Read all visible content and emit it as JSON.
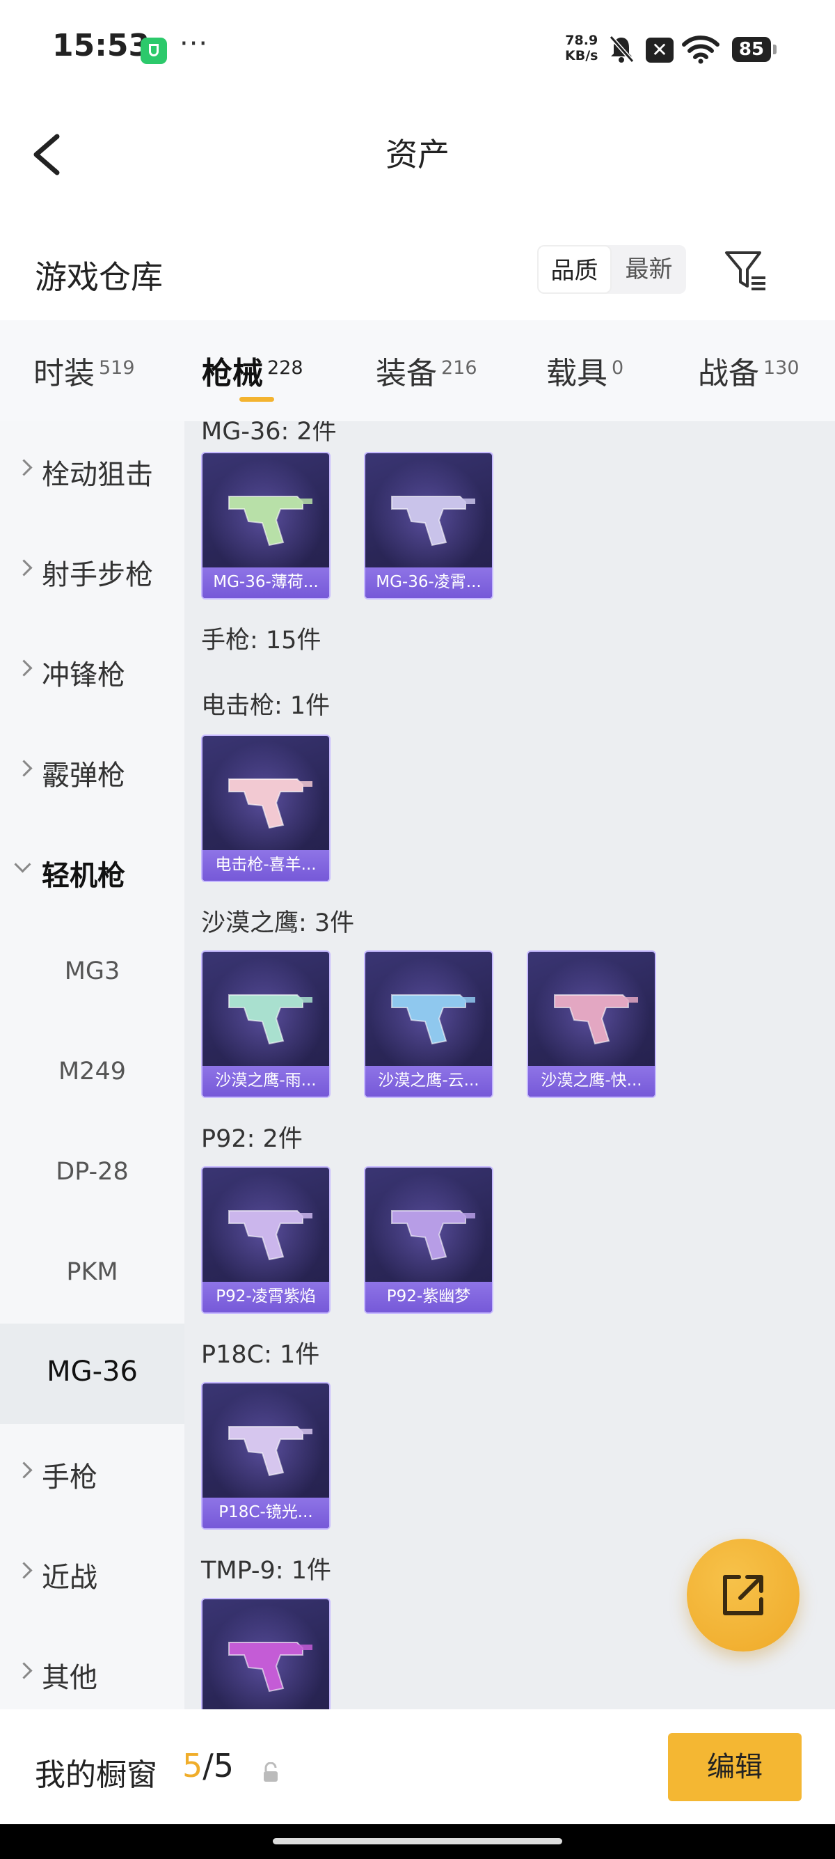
{
  "status": {
    "time": "15:53",
    "more": "···",
    "net_speed_value": "78.9",
    "net_speed_unit": "KB/s",
    "battery": "85"
  },
  "nav": {
    "title": "资产"
  },
  "warehouse": {
    "title": "游戏仓库",
    "sort": [
      "品质",
      "最新"
    ],
    "active_sort": 0
  },
  "tabs": [
    {
      "label": "时装",
      "count": "519"
    },
    {
      "label": "枪械",
      "count": "228",
      "active": true
    },
    {
      "label": "装备",
      "count": "216"
    },
    {
      "label": "载具",
      "count": "0"
    },
    {
      "label": "战备",
      "count": "130"
    }
  ],
  "sidebar": {
    "items": [
      {
        "label": "栓动狙击",
        "type": "category"
      },
      {
        "label": "射手步枪",
        "type": "category"
      },
      {
        "label": "冲锋枪",
        "type": "category"
      },
      {
        "label": "霰弹枪",
        "type": "category"
      },
      {
        "label": "轻机枪",
        "type": "category",
        "expanded": true
      },
      {
        "label": "MG3",
        "type": "sub"
      },
      {
        "label": "M249",
        "type": "sub"
      },
      {
        "label": "DP-28",
        "type": "sub"
      },
      {
        "label": "PKM",
        "type": "sub"
      },
      {
        "label": "MG-36",
        "type": "sub",
        "selected": true
      },
      {
        "label": "手枪",
        "type": "category"
      },
      {
        "label": "近战",
        "type": "category"
      },
      {
        "label": "其他",
        "type": "category"
      }
    ]
  },
  "groups": [
    {
      "title": "MG-36: 2件",
      "items": [
        {
          "name": "MG-36-薄荷...",
          "tint": "#b8e0a8"
        },
        {
          "name": "MG-36-凌霄...",
          "tint": "#c9c3ea"
        }
      ]
    },
    {
      "title": "手枪: 15件",
      "items": []
    },
    {
      "title": "电击枪: 1件",
      "items": [
        {
          "name": "电击枪-喜羊...",
          "tint": "#f2c9d2"
        }
      ]
    },
    {
      "title": "沙漠之鹰: 3件",
      "items": [
        {
          "name": "沙漠之鹰-雨...",
          "tint": "#a9e0cf"
        },
        {
          "name": "沙漠之鹰-云...",
          "tint": "#8fc8ee"
        },
        {
          "name": "沙漠之鹰-快...",
          "tint": "#e3a7c2"
        }
      ]
    },
    {
      "title": "P92: 2件",
      "items": [
        {
          "name": "P92-凌霄紫焰",
          "tint": "#cbb6ec"
        },
        {
          "name": "P92-紫幽梦",
          "tint": "#b79de6"
        }
      ]
    },
    {
      "title": "P18C: 1件",
      "items": [
        {
          "name": "P18C-镜光...",
          "tint": "#d6c6ee"
        }
      ]
    },
    {
      "title": "TMP-9: 1件",
      "items": [
        {
          "name": "",
          "tint": "#c45cd6"
        }
      ]
    }
  ],
  "bottom": {
    "window_label": "我的橱窗",
    "current": "5",
    "total": "/5",
    "edit_label": "编辑"
  }
}
